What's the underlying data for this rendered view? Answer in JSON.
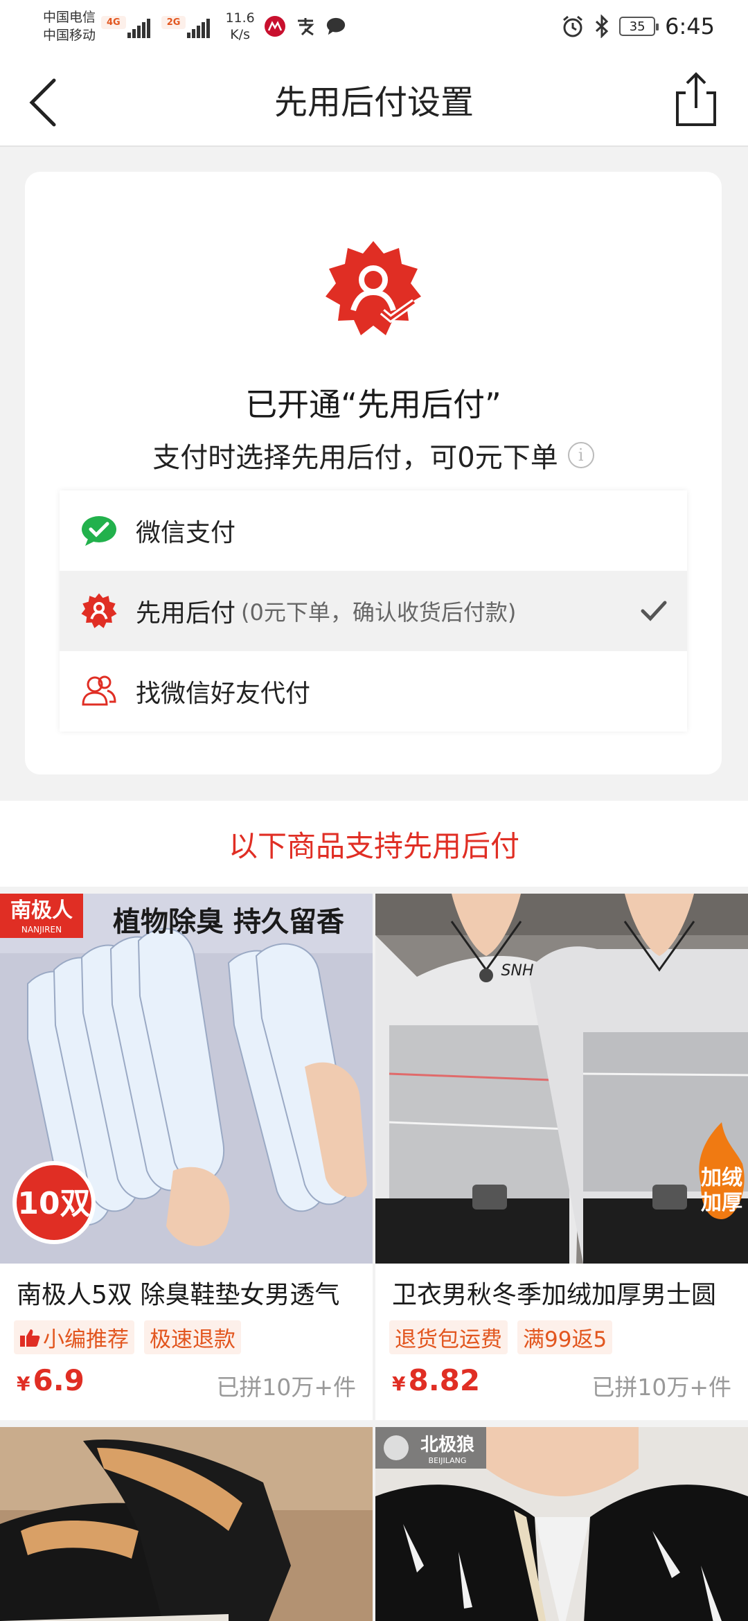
{
  "status_bar": {
    "carrier_1": "中国电信",
    "carrier_2": "中国移动",
    "net_1": "4G",
    "net_2": "2G",
    "speed_value": "11.6",
    "speed_unit": "K/s",
    "battery": "35",
    "time": "6:45"
  },
  "nav": {
    "title": "先用后付设置"
  },
  "card": {
    "enabled_title": "已开通“先用后付”",
    "enabled_subtitle": "支付时选择先用后付，可0元下单",
    "options": [
      {
        "label": "微信支付",
        "note": "",
        "icon": "wechat-pay-icon",
        "selected": false
      },
      {
        "label": "先用后付",
        "note": "(0元下单，确认收货后付款)",
        "icon": "pay-later-badge-icon",
        "selected": true
      },
      {
        "label": "找微信好友代付",
        "note": "",
        "icon": "friends-pay-icon",
        "selected": false
      }
    ]
  },
  "section": {
    "heading": "以下商品支持先用后付"
  },
  "products": [
    {
      "brand": "南极人",
      "brand_en": "NANJIREN",
      "banner": "植物除臭 持久留香",
      "badge": "10双",
      "title": "南极人5双 除臭鞋垫女男透气",
      "tags": [
        "小编推荐",
        "极速退款"
      ],
      "price": "6.9",
      "sold": "已拼10万+件"
    },
    {
      "print": "SNH",
      "badge": "加绒\n加厚",
      "title": "卫衣男秋冬季加绒加厚男士圆",
      "tags": [
        "退货包运费",
        "满99返5"
      ],
      "price": "8.82",
      "sold": "已拼10万+件"
    },
    {
      "title": ""
    },
    {
      "brand": "北极狼",
      "brand_en": "BEIJILANG",
      "title": ""
    }
  ],
  "currency": "¥",
  "colors": {
    "accent_red": "#e02e24",
    "tag_orange": "#e2561f",
    "wechat_green": "#22b14c"
  }
}
